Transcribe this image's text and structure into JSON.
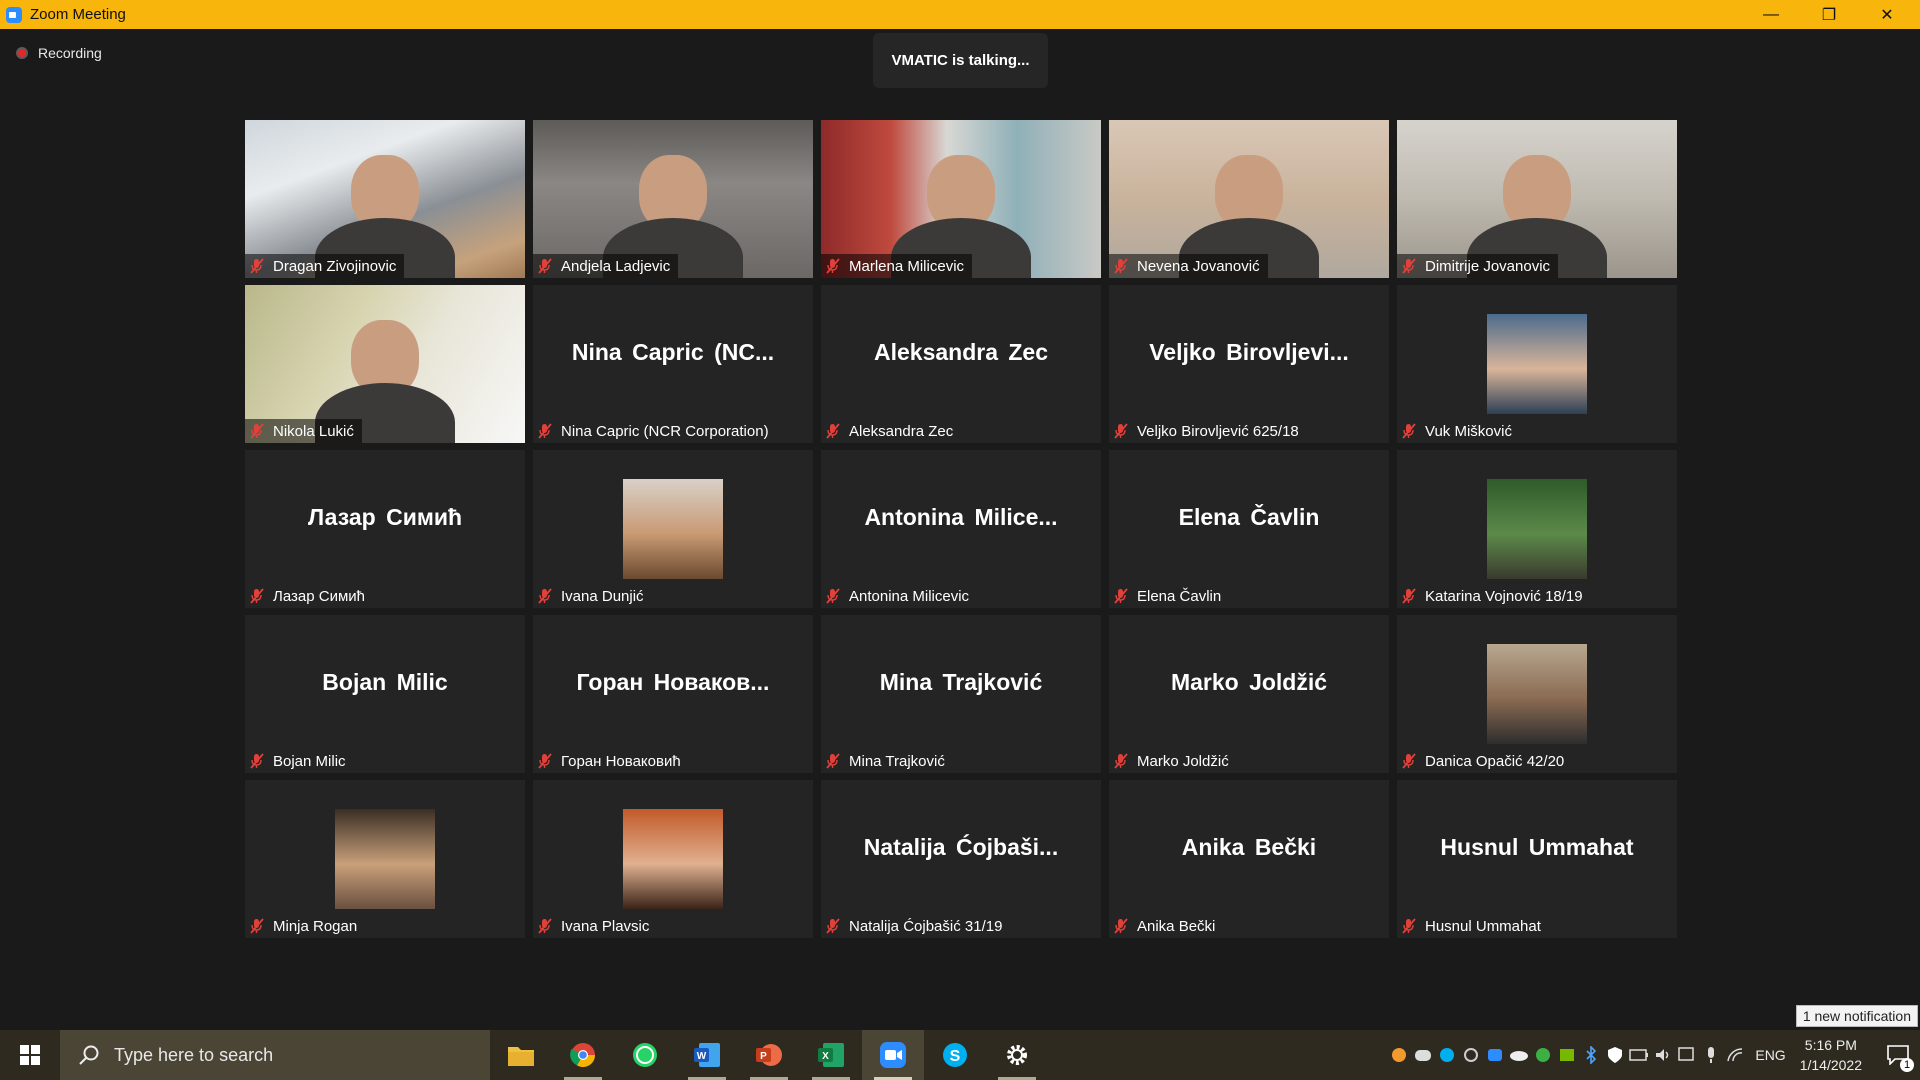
{
  "window": {
    "title": "Zoom Meeting",
    "controls": [
      "minimize",
      "restore",
      "close"
    ]
  },
  "recording": {
    "label": "Recording"
  },
  "talking": {
    "text": "VMATIC is talking..."
  },
  "participants": [
    {
      "name": "Dragan Zivojinovic",
      "display": "",
      "mode": "video",
      "video": "v1"
    },
    {
      "name": "Andjela Ladjevic",
      "display": "",
      "mode": "video",
      "video": "v2"
    },
    {
      "name": "Marlena Milicevic",
      "display": "",
      "mode": "video",
      "video": "v3"
    },
    {
      "name": "Nevena Jovanović",
      "display": "",
      "mode": "video",
      "video": "v4"
    },
    {
      "name": "Dimitrije Jovanovic",
      "display": "",
      "mode": "video",
      "video": "v5"
    },
    {
      "name": "Nikola Lukić",
      "display": "",
      "mode": "video",
      "video": "v6"
    },
    {
      "name": "Nina Capric (NCR Corporation)",
      "display": "Nina Capric (NC...",
      "mode": "name",
      "video": ""
    },
    {
      "name": "Aleksandra Zec",
      "display": "Aleksandra Zec",
      "mode": "name",
      "video": ""
    },
    {
      "name": "Veljko Birovljević 625/18",
      "display": "Veljko Birovljevi...",
      "mode": "name",
      "video": ""
    },
    {
      "name": "Vuk Mišković",
      "display": "",
      "mode": "avatar",
      "video": "a1"
    },
    {
      "name": "Лазар Симић",
      "display": "Лазар Симић",
      "mode": "name",
      "video": ""
    },
    {
      "name": "Ivana Dunjić",
      "display": "",
      "mode": "avatar",
      "video": "a2"
    },
    {
      "name": "Antonina Milicevic",
      "display": "Antonina Milice...",
      "mode": "name",
      "video": ""
    },
    {
      "name": "Elena Čavlin",
      "display": "Elena Čavlin",
      "mode": "name",
      "video": ""
    },
    {
      "name": "Katarina Vojnović 18/19",
      "display": "",
      "mode": "avatar",
      "video": "a3"
    },
    {
      "name": "Bojan Milic",
      "display": "Bojan Milic",
      "mode": "name",
      "video": ""
    },
    {
      "name": "Горан Новаковић",
      "display": "Горан Новаков...",
      "mode": "name",
      "video": ""
    },
    {
      "name": "Mina Trajković",
      "display": "Mina Trajković",
      "mode": "name",
      "video": ""
    },
    {
      "name": "Marko Joldžić",
      "display": "Marko Joldžić",
      "mode": "name",
      "video": ""
    },
    {
      "name": "Danica Opačić 42/20",
      "display": "",
      "mode": "avatar",
      "video": "a4"
    },
    {
      "name": "Minja Rogan",
      "display": "",
      "mode": "avatar",
      "video": "a5"
    },
    {
      "name": "Ivana Plavsic",
      "display": "",
      "mode": "avatar",
      "video": "a6"
    },
    {
      "name": "Natalija Ćojbašić 31/19",
      "display": "Natalija Ćojbaši...",
      "mode": "name",
      "video": ""
    },
    {
      "name": "Anika Bečki",
      "display": "Anika Bečki",
      "mode": "name",
      "video": ""
    },
    {
      "name": "Husnul Ummahat",
      "display": "Husnul Ummahat",
      "mode": "name",
      "video": ""
    }
  ],
  "taskbar": {
    "search_placeholder": "Type here to search",
    "apps": [
      "file-explorer",
      "chrome",
      "whatsapp",
      "word",
      "powerpoint",
      "excel",
      "zoom",
      "skype",
      "settings"
    ],
    "active_app": "zoom",
    "language": "ENG",
    "time": "5:16 PM",
    "date": "1/14/2022",
    "notification_toast": "1 new notification",
    "notification_count": "1"
  },
  "colors": {
    "titlebar": "#f8b50b",
    "background": "#1a1a1a",
    "tile": "#242424",
    "mic_muted": "#e0413b"
  }
}
